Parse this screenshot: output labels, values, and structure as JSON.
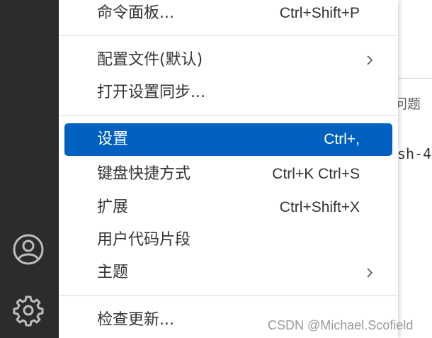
{
  "background": {
    "tab_fragment": "问题",
    "code_fragment": "sh-4"
  },
  "activity_bar": {
    "icons": [
      "account-icon",
      "settings-gear-icon"
    ]
  },
  "menu": {
    "items": [
      {
        "label": "命令面板...",
        "shortcut": "Ctrl+Shift+P"
      },
      {
        "label": "配置文件(默认)",
        "shortcut": "",
        "submenu": true
      },
      {
        "label": "打开设置同步...",
        "shortcut": ""
      },
      {
        "label": "设置",
        "shortcut": "Ctrl+,",
        "active": true
      },
      {
        "label": "键盘快捷方式",
        "shortcut": "Ctrl+K Ctrl+S"
      },
      {
        "label": "扩展",
        "shortcut": "Ctrl+Shift+X"
      },
      {
        "label": "用户代码片段",
        "shortcut": ""
      },
      {
        "label": "主题",
        "shortcut": "",
        "submenu": true
      },
      {
        "label": "检查更新...",
        "shortcut": ""
      }
    ]
  },
  "watermark": "CSDN @Michael.Scofield",
  "colors": {
    "activity_bar": "#2c2c2c",
    "menu_background": "#ffffff",
    "active_item": "#0060c0",
    "text": "#333333"
  }
}
